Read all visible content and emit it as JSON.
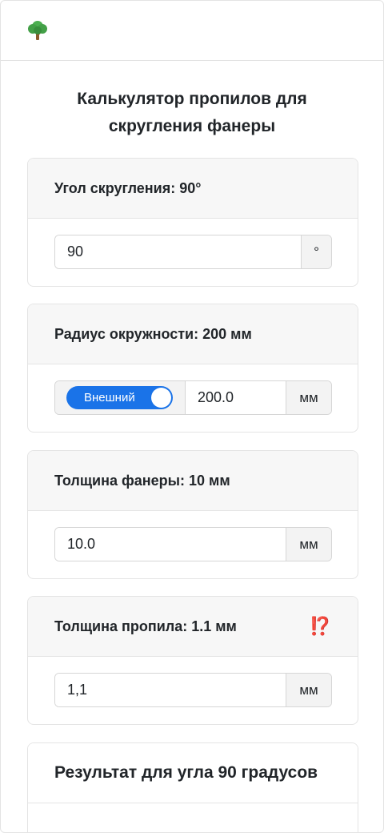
{
  "navbar": {
    "logo_icon": "deciduous-tree-icon"
  },
  "page_title": "Калькулятор пропилов для скругления фанеры",
  "angle": {
    "label": "Угол скругления: 90°",
    "value": "90",
    "unit": "°"
  },
  "radius": {
    "label": "Радиус окружности: 200 мм",
    "toggle_label": "Внешний",
    "toggle_on": true,
    "value": "200.0",
    "unit": "мм"
  },
  "thickness": {
    "label": "Толщина фанеры: 10 мм",
    "value": "10.0",
    "unit": "мм"
  },
  "kerf": {
    "label": "Толщина пропила: 1.1 мм",
    "warning_icon": "⁉️",
    "value": "1,1",
    "unit": "мм"
  },
  "result": {
    "label": "Результат для угла 90 градусов"
  },
  "colors": {
    "accent": "#1a73e8",
    "warning": "#e0403a",
    "header_bg": "#f7f7f7"
  }
}
